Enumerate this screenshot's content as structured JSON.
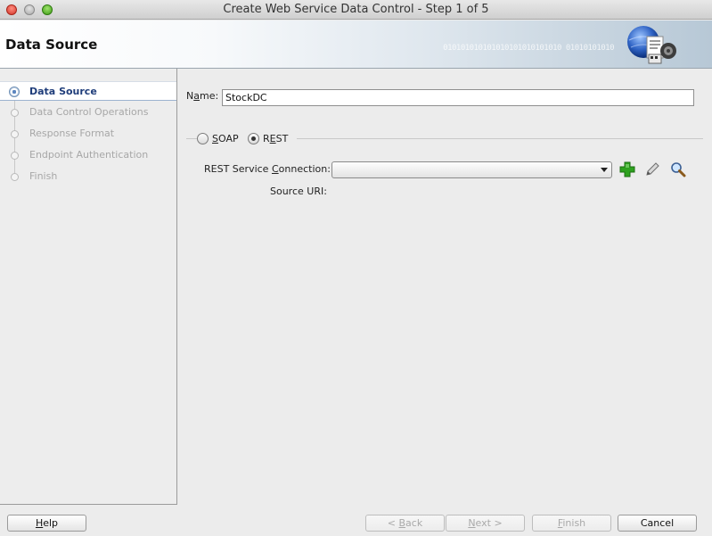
{
  "window": {
    "title": "Create Web Service Data Control - Step 1 of 5"
  },
  "header": {
    "title": "Data Source",
    "binary_decor": "010101010101010101010101010 01010101010"
  },
  "steps": [
    {
      "label": "Data Source",
      "active": true
    },
    {
      "label": "Data Control Operations",
      "active": false
    },
    {
      "label": "Response Format",
      "active": false
    },
    {
      "label": "Endpoint Authentication",
      "active": false
    },
    {
      "label": "Finish",
      "active": false
    }
  ],
  "form": {
    "name_label_pre": "N",
    "name_label_mn": "a",
    "name_label_post": "me:",
    "name_value": "StockDC",
    "soap_label_mn": "S",
    "soap_label_rest": "OAP",
    "rest_label_pre": "R",
    "rest_label_mn": "E",
    "rest_label_post": "ST",
    "selected_type": "REST",
    "connection_label_pre": "REST Service ",
    "connection_label_mn": "C",
    "connection_label_post": "onnection:",
    "connection_value": "",
    "source_uri_label": "Source URI:",
    "source_uri_value": ""
  },
  "icons": {
    "add": "plus-icon",
    "edit": "pencil-icon",
    "browse": "magnifier-icon"
  },
  "buttons": {
    "help_mn": "H",
    "help_rest": "elp",
    "back_pre": "< ",
    "back_mn": "B",
    "back_rest": "ack",
    "next_mn": "N",
    "next_rest": "ext >",
    "finish_mn": "F",
    "finish_rest": "inish",
    "cancel": "Cancel"
  },
  "colors": {
    "active_step": "#1f3d7a",
    "disabled_text": "#a9a9a9",
    "add_icon": "#2ea11f"
  }
}
